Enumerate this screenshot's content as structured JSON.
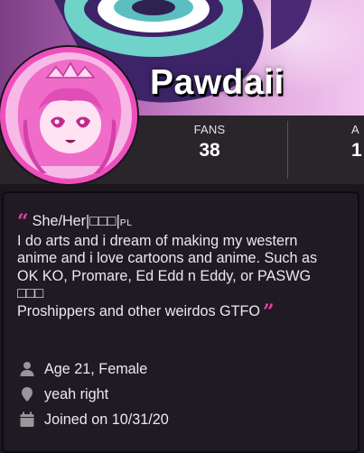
{
  "profile": {
    "display_name": "Pawdaii"
  },
  "stats": {
    "fans_label": "FANS",
    "fans_value": "38",
    "cut_label": "A",
    "cut_value": "1"
  },
  "bio": {
    "line1": "She/Her|□□□|",
    "line1_suffix": "PL",
    "line2": "I do arts and i dream of making my western",
    "line3": "anime and i love cartoons and anime. Such as",
    "line4": "OK KO, Promare, Ed Edd n Eddy, or PASWG",
    "line5": "□□□",
    "line6": "Proshippers and other weirdos GTFO"
  },
  "info": {
    "age_gender": "Age 21, Female",
    "location": "yeah right",
    "joined": "Joined on 10/31/20"
  },
  "icons": {
    "age": "person-icon",
    "location": "location-pin-icon",
    "joined": "calendar-icon"
  },
  "colors": {
    "accent_pink": "#e6409e",
    "avatar_ring": "#ef4fbd",
    "stats_bar": "#2a242b",
    "card_bg": "#201a23",
    "icon_gray": "#9a949b"
  }
}
